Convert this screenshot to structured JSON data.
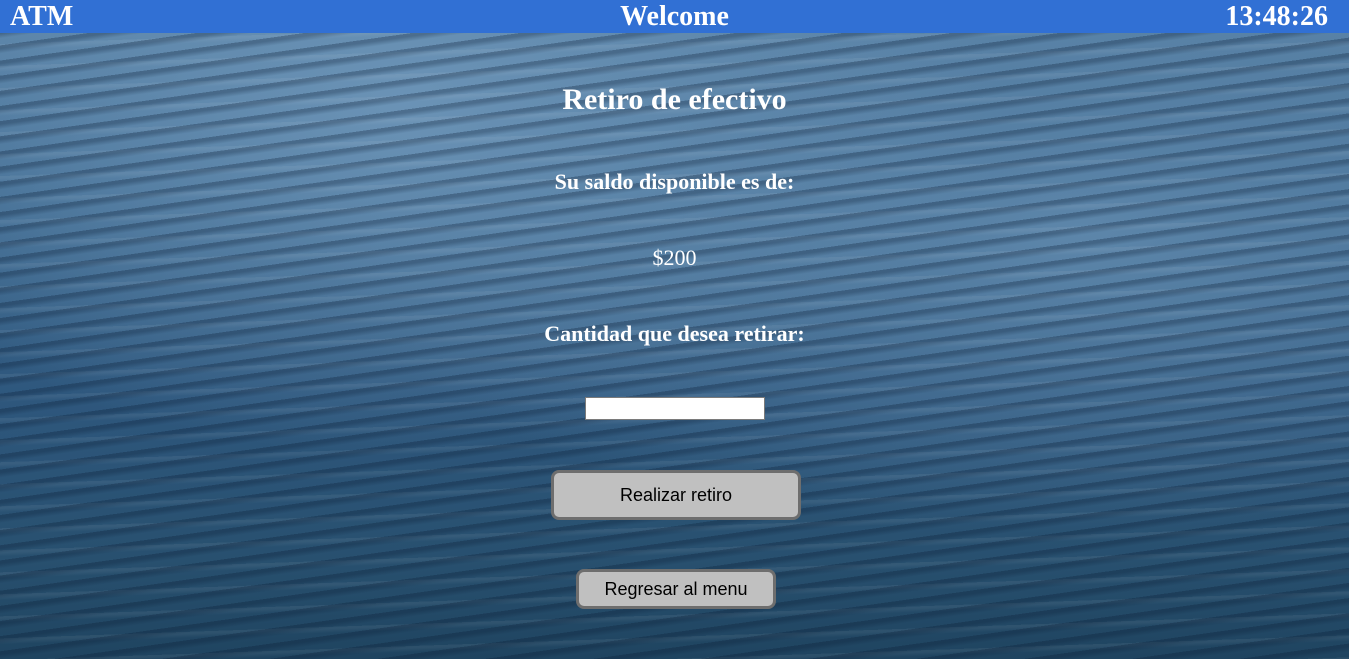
{
  "header": {
    "brand": "ATM",
    "title": "Welcome",
    "time": "13:48:26"
  },
  "withdraw": {
    "title": "Retiro de efectivo",
    "balance_label": "Su saldo disponible es de:",
    "balance_value": "$200",
    "amount_label": "Cantidad que desea retirar:",
    "amount_value": "",
    "submit_label": "Realizar retiro",
    "back_label": "Regresar al menu"
  },
  "colors": {
    "header_bg": "#3170d4",
    "button_bg": "#c0c0c0",
    "text": "#ffffff"
  }
}
